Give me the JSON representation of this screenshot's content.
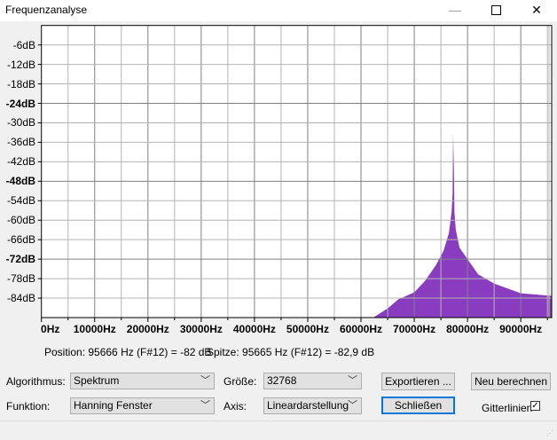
{
  "window": {
    "title": "Frequenzanalyse",
    "minimize_icon": "minimize-icon",
    "maximize_icon": "maximize-icon",
    "close_icon": "close-icon"
  },
  "status": {
    "position": "Position: 95666 Hz (F#12) = -82 dB",
    "peak": "Spitze: 95665 Hz (F#12) = -82,9 dB"
  },
  "controls": {
    "algorithm_label": "Algorithmus:",
    "algorithm_value": "Spektrum",
    "size_label": "Größe:",
    "size_value": "32768",
    "function_label": "Funktion:",
    "function_value": "Hanning Fenster",
    "axis_label": "Axis:",
    "axis_value": "Lineardarstellung",
    "export_button": "Exportieren ...",
    "recalc_button": "Neu berechnen",
    "close_button": "Schließen",
    "grid_label": "Gitterlinien",
    "grid_checked": true
  },
  "chart_data": {
    "type": "area",
    "xlabel": "",
    "ylabel": "",
    "xlim": [
      0,
      95800
    ],
    "ylim": [
      -90,
      0
    ],
    "x_ticks": [
      "0Hz",
      "10000Hz",
      "20000Hz",
      "30000Hz",
      "40000Hz",
      "50000Hz",
      "60000Hz",
      "70000Hz",
      "80000Hz",
      "90000Hz"
    ],
    "y_ticks": [
      "-6dB",
      "-12dB",
      "-18dB",
      "-24dB",
      "-30dB",
      "-36dB",
      "-42dB",
      "-48dB",
      "-54dB",
      "-60dB",
      "-66dB",
      "-72dB",
      "-78dB",
      "-84dB"
    ],
    "bold_y_ticks": [
      "-24dB",
      "-48dB",
      "-72dB"
    ],
    "grid": true,
    "color": "#8a3cc0",
    "series": [
      {
        "name": "Spektrum",
        "points": [
          [
            62300,
            -90
          ],
          [
            65000,
            -87.2
          ],
          [
            67000,
            -84.4
          ],
          [
            70000,
            -82.2
          ],
          [
            72000,
            -78.7
          ],
          [
            74000,
            -74
          ],
          [
            75500,
            -69.4
          ],
          [
            76500,
            -64
          ],
          [
            77000,
            -57.6
          ],
          [
            77200,
            -52
          ],
          [
            77300,
            -33.4
          ],
          [
            77450,
            -45
          ],
          [
            77550,
            -57.6
          ],
          [
            77800,
            -63
          ],
          [
            78500,
            -68.5
          ],
          [
            80000,
            -72
          ],
          [
            82000,
            -76.7
          ],
          [
            85000,
            -79.5
          ],
          [
            90000,
            -82.5
          ],
          [
            95800,
            -83.3
          ]
        ]
      }
    ]
  }
}
